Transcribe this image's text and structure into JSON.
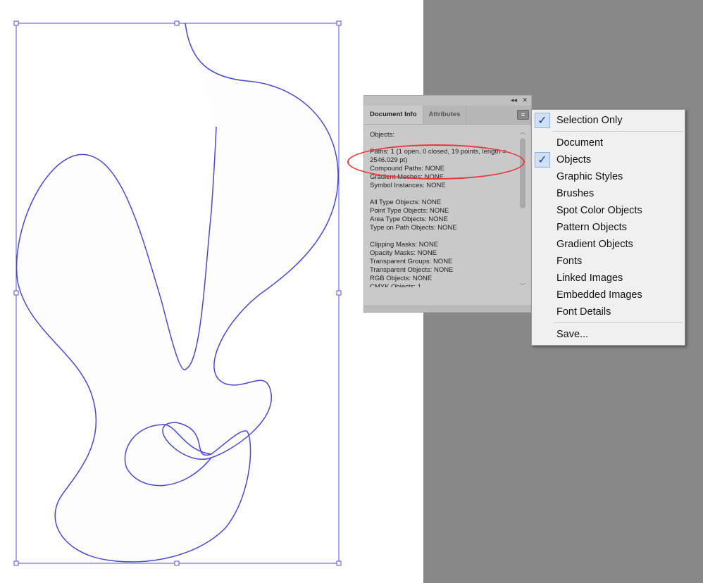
{
  "panel": {
    "collapse_icon": "double-chevron-left-icon",
    "close_icon": "close-icon",
    "tabs": [
      "Document Info",
      "Attributes"
    ],
    "menu_icon": "hamburger-menu-icon",
    "lines": [
      "Objects:",
      "",
      "Paths: 1 (1 open, 0 closed, 19 points, length =",
      "2546.029 pt)",
      "Compound Paths: NONE",
      "Gradient Meshes: NONE",
      "Symbol Instances: NONE",
      "",
      "All Type Objects: NONE",
      "Point Type Objects: NONE",
      "Area Type Objects: NONE",
      "Type on Path Objects: NONE",
      "",
      "Clipping Masks: NONE",
      "Opacity Masks: NONE",
      "Transparent Groups: NONE",
      "Transparent Objects: NONE",
      "RGB Objects: NONE",
      "CMYK Objects: 1"
    ]
  },
  "menu": {
    "items": [
      {
        "label": "Selection Only",
        "checked": true
      },
      {
        "label": "Document",
        "checked": false
      },
      {
        "label": "Objects",
        "checked": true
      },
      {
        "label": "Graphic Styles",
        "checked": false
      },
      {
        "label": "Brushes",
        "checked": false
      },
      {
        "label": "Spot Color Objects",
        "checked": false
      },
      {
        "label": "Pattern Objects",
        "checked": false
      },
      {
        "label": "Gradient Objects",
        "checked": false
      },
      {
        "label": "Fonts",
        "checked": false
      },
      {
        "label": "Linked Images",
        "checked": false
      },
      {
        "label": "Embedded Images",
        "checked": false
      },
      {
        "label": "Font Details",
        "checked": false
      },
      {
        "label": "Save...",
        "checked": false
      }
    ],
    "check": "✓"
  },
  "colors": {
    "path": "#4040c0",
    "highlight": "#e8393c",
    "pasteboard": "#888888"
  }
}
